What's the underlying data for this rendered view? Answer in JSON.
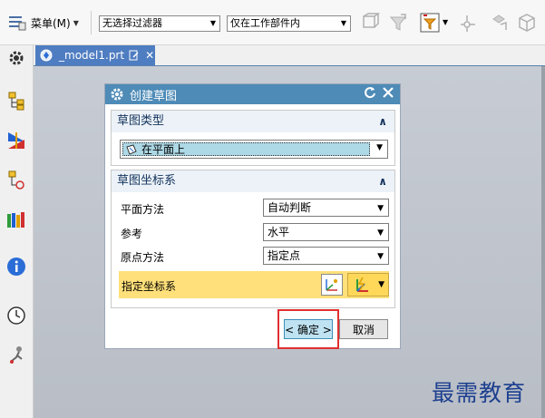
{
  "toolbar": {
    "menu_label": "菜单(M)",
    "filter_combo": "无选择过滤器",
    "scope_combo": "仅在工作部件内"
  },
  "tab": {
    "title": "_model1.prt"
  },
  "dialog": {
    "title": "创建草图",
    "sketch_type": {
      "header": "草图类型",
      "selected": "在平面上"
    },
    "csys": {
      "header": "草图坐标系",
      "plane_method_label": "平面方法",
      "plane_method_value": "自动判断",
      "reference_label": "参考",
      "reference_value": "水平",
      "origin_method_label": "原点方法",
      "origin_method_value": "指定点",
      "specify_csys_label": "指定坐标系"
    },
    "ok_label": "< 确定 >",
    "cancel_label": "取消"
  },
  "watermark": "最需教育",
  "colors": {
    "title_bar": "#4e8bb7",
    "highlight_row": "#ffe07a",
    "ok_frame": "#e03030"
  }
}
